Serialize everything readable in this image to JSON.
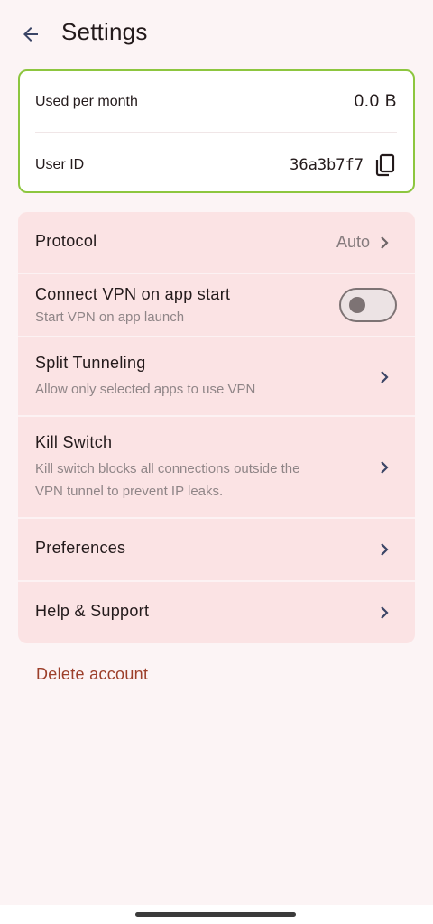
{
  "header": {
    "title": "Settings"
  },
  "account": {
    "used_label": "Used per month",
    "used_value": "0.0 B",
    "userid_label": "User ID",
    "userid_value": "36a3b7f7"
  },
  "settings": {
    "protocol": {
      "title": "Protocol",
      "value": "Auto"
    },
    "connect_on_start": {
      "title": "Connect VPN on app start",
      "subtitle": "Start VPN on app launch",
      "enabled": false
    },
    "split_tunneling": {
      "title": "Split Tunneling",
      "subtitle": "Allow only selected apps to use VPN"
    },
    "kill_switch": {
      "title": "Kill Switch",
      "subtitle_line1": "Kill switch blocks all connections outside the",
      "subtitle_line2": "VPN tunnel to prevent IP leaks."
    },
    "preferences": {
      "title": "Preferences"
    },
    "help": {
      "title": "Help & Support"
    }
  },
  "delete_account": "Delete account",
  "colors": {
    "card_border": "#8dc63f",
    "list_bg": "#fbe3e4",
    "page_bg": "#fcf4f5",
    "delete_text": "#9c3f2a"
  },
  "icons": [
    "arrow-back-icon",
    "copy-icon",
    "chevron-right-icon"
  ]
}
